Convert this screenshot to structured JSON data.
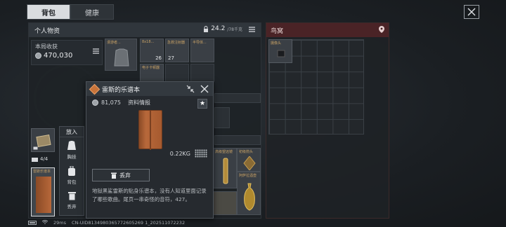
{
  "tabs": [
    {
      "label": "背包",
      "active": true
    },
    {
      "label": "健康",
      "active": false
    }
  ],
  "personal": {
    "title": "个人物资",
    "weight_value": "24.2",
    "weight_cap": "/78千克",
    "income_label": "本局收获",
    "income_value": "470,030"
  },
  "grid_items": [
    {
      "label": "漫游者...",
      "count": ""
    },
    {
      "label": "8x18...",
      "count": "26"
    },
    {
      "label": "急救注射器",
      "count": "27"
    },
    {
      "label": "半导体...",
      "count": ""
    },
    {
      "label": "电子卡顿器",
      "count": ""
    }
  ],
  "nest": {
    "title": "鸟窝",
    "item_label": "摄像头"
  },
  "popup": {
    "title": "雷斯的乐谱本",
    "price": "81,075",
    "category": "资料情报",
    "weight": "0.22KG",
    "discard_label": "丢弃",
    "description": "地狱黑鲨雷斯的贴身乐谱本，没有人知道里面记录了哪些歌曲。尾页一串奇怪的音符，427。"
  },
  "action_menu": {
    "title": "放入",
    "items": [
      {
        "label": "胸挂",
        "icon": "vest-icon"
      },
      {
        "label": "背包",
        "icon": "backpack-icon"
      },
      {
        "label": "丢弃",
        "icon": "trash-icon"
      }
    ]
  },
  "left_items": {
    "count_badge": "4/4",
    "book_label": "雷斯乐谱本"
  },
  "right_items": {
    "label1": "高级望远镜",
    "label2": "阿萨拉酒壶",
    "label3": "初级箭头"
  },
  "status": {
    "ping": "29ms",
    "uid": "CN-UID8134980365772605269 1_202511072232"
  },
  "colors": {
    "accent_nest": "#4a2326",
    "book": "#b7683a",
    "highlight": "#c8743a"
  }
}
